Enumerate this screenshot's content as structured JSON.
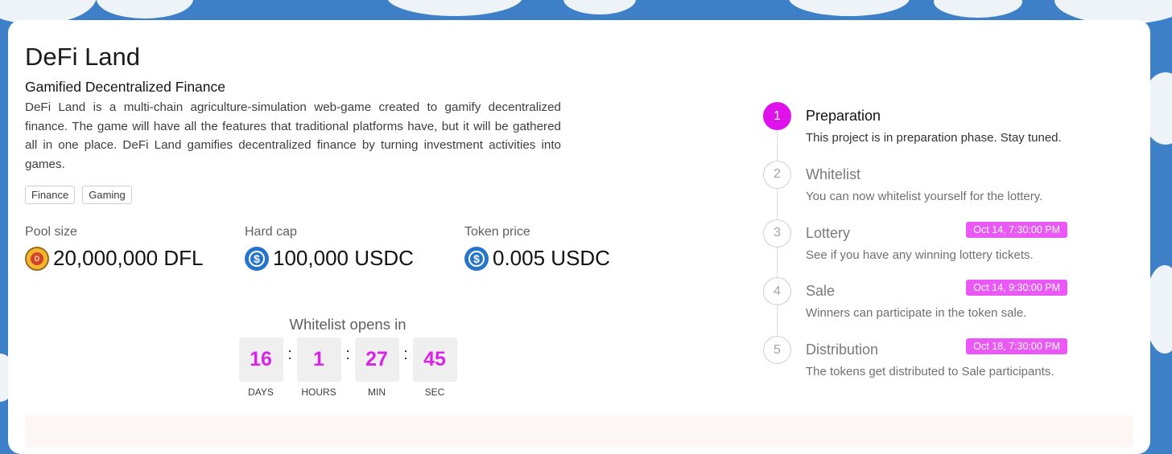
{
  "project": {
    "name": "DeFi Land",
    "tagline": "Gamified Decentralized Finance",
    "description": "DeFi Land is a multi-chain agriculture-simulation web-game created to gamify decentralized finance. The game will have all the features that traditional platforms have, but it will be gathered all in one place. DeFi Land gamifies decentralized finance by turning investment activities into games.",
    "tags": [
      "Finance",
      "Gaming"
    ]
  },
  "stats": {
    "pool_size": {
      "label": "Pool size",
      "value": "20,000,000 DFL",
      "icon": "dfl-token-icon"
    },
    "hard_cap": {
      "label": "Hard cap",
      "value": "100,000 USDC",
      "icon": "usdc-icon"
    },
    "token_price": {
      "label": "Token price",
      "value": "0.005 USDC",
      "icon": "usdc-icon"
    }
  },
  "countdown": {
    "title": "Whitelist opens in",
    "units": [
      {
        "value": "16",
        "label": "DAYS"
      },
      {
        "value": "1",
        "label": "HOURS"
      },
      {
        "value": "27",
        "label": "MIN"
      },
      {
        "value": "45",
        "label": "SEC"
      }
    ]
  },
  "timeline": {
    "steps": [
      {
        "num": "1",
        "title": "Preparation",
        "desc": "This project is in preparation phase. Stay tuned.",
        "date": "",
        "active": true
      },
      {
        "num": "2",
        "title": "Whitelist",
        "desc": "You can now whitelist yourself for the lottery.",
        "date": "",
        "active": false
      },
      {
        "num": "3",
        "title": "Lottery",
        "desc": "See if you have any winning lottery tickets.",
        "date": "Oct 14, 7:30:00 PM",
        "active": false
      },
      {
        "num": "4",
        "title": "Sale",
        "desc": "Winners can participate in the token sale.",
        "date": "Oct 14, 9:30:00 PM",
        "active": false
      },
      {
        "num": "5",
        "title": "Distribution",
        "desc": "The tokens get distributed to Sale participants.",
        "date": "Oct 18, 7:30:00 PM",
        "active": false
      }
    ]
  },
  "colors": {
    "accent": "#df12eb",
    "date_badge": "#ea58f6",
    "background": "#3d80c8",
    "usdc": "#2775ca"
  }
}
